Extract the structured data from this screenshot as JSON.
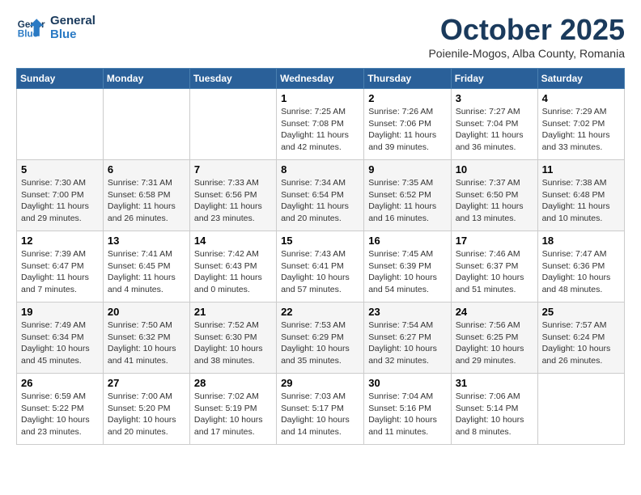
{
  "header": {
    "logo_line1": "General",
    "logo_line2": "Blue",
    "month": "October 2025",
    "location": "Poienile-Mogos, Alba County, Romania"
  },
  "days_of_week": [
    "Sunday",
    "Monday",
    "Tuesday",
    "Wednesday",
    "Thursday",
    "Friday",
    "Saturday"
  ],
  "weeks": [
    [
      {
        "day": "",
        "info": ""
      },
      {
        "day": "",
        "info": ""
      },
      {
        "day": "",
        "info": ""
      },
      {
        "day": "1",
        "info": "Sunrise: 7:25 AM\nSunset: 7:08 PM\nDaylight: 11 hours\nand 42 minutes."
      },
      {
        "day": "2",
        "info": "Sunrise: 7:26 AM\nSunset: 7:06 PM\nDaylight: 11 hours\nand 39 minutes."
      },
      {
        "day": "3",
        "info": "Sunrise: 7:27 AM\nSunset: 7:04 PM\nDaylight: 11 hours\nand 36 minutes."
      },
      {
        "day": "4",
        "info": "Sunrise: 7:29 AM\nSunset: 7:02 PM\nDaylight: 11 hours\nand 33 minutes."
      }
    ],
    [
      {
        "day": "5",
        "info": "Sunrise: 7:30 AM\nSunset: 7:00 PM\nDaylight: 11 hours\nand 29 minutes."
      },
      {
        "day": "6",
        "info": "Sunrise: 7:31 AM\nSunset: 6:58 PM\nDaylight: 11 hours\nand 26 minutes."
      },
      {
        "day": "7",
        "info": "Sunrise: 7:33 AM\nSunset: 6:56 PM\nDaylight: 11 hours\nand 23 minutes."
      },
      {
        "day": "8",
        "info": "Sunrise: 7:34 AM\nSunset: 6:54 PM\nDaylight: 11 hours\nand 20 minutes."
      },
      {
        "day": "9",
        "info": "Sunrise: 7:35 AM\nSunset: 6:52 PM\nDaylight: 11 hours\nand 16 minutes."
      },
      {
        "day": "10",
        "info": "Sunrise: 7:37 AM\nSunset: 6:50 PM\nDaylight: 11 hours\nand 13 minutes."
      },
      {
        "day": "11",
        "info": "Sunrise: 7:38 AM\nSunset: 6:48 PM\nDaylight: 11 hours\nand 10 minutes."
      }
    ],
    [
      {
        "day": "12",
        "info": "Sunrise: 7:39 AM\nSunset: 6:47 PM\nDaylight: 11 hours\nand 7 minutes."
      },
      {
        "day": "13",
        "info": "Sunrise: 7:41 AM\nSunset: 6:45 PM\nDaylight: 11 hours\nand 4 minutes."
      },
      {
        "day": "14",
        "info": "Sunrise: 7:42 AM\nSunset: 6:43 PM\nDaylight: 11 hours\nand 0 minutes."
      },
      {
        "day": "15",
        "info": "Sunrise: 7:43 AM\nSunset: 6:41 PM\nDaylight: 10 hours\nand 57 minutes."
      },
      {
        "day": "16",
        "info": "Sunrise: 7:45 AM\nSunset: 6:39 PM\nDaylight: 10 hours\nand 54 minutes."
      },
      {
        "day": "17",
        "info": "Sunrise: 7:46 AM\nSunset: 6:37 PM\nDaylight: 10 hours\nand 51 minutes."
      },
      {
        "day": "18",
        "info": "Sunrise: 7:47 AM\nSunset: 6:36 PM\nDaylight: 10 hours\nand 48 minutes."
      }
    ],
    [
      {
        "day": "19",
        "info": "Sunrise: 7:49 AM\nSunset: 6:34 PM\nDaylight: 10 hours\nand 45 minutes."
      },
      {
        "day": "20",
        "info": "Sunrise: 7:50 AM\nSunset: 6:32 PM\nDaylight: 10 hours\nand 41 minutes."
      },
      {
        "day": "21",
        "info": "Sunrise: 7:52 AM\nSunset: 6:30 PM\nDaylight: 10 hours\nand 38 minutes."
      },
      {
        "day": "22",
        "info": "Sunrise: 7:53 AM\nSunset: 6:29 PM\nDaylight: 10 hours\nand 35 minutes."
      },
      {
        "day": "23",
        "info": "Sunrise: 7:54 AM\nSunset: 6:27 PM\nDaylight: 10 hours\nand 32 minutes."
      },
      {
        "day": "24",
        "info": "Sunrise: 7:56 AM\nSunset: 6:25 PM\nDaylight: 10 hours\nand 29 minutes."
      },
      {
        "day": "25",
        "info": "Sunrise: 7:57 AM\nSunset: 6:24 PM\nDaylight: 10 hours\nand 26 minutes."
      }
    ],
    [
      {
        "day": "26",
        "info": "Sunrise: 6:59 AM\nSunset: 5:22 PM\nDaylight: 10 hours\nand 23 minutes."
      },
      {
        "day": "27",
        "info": "Sunrise: 7:00 AM\nSunset: 5:20 PM\nDaylight: 10 hours\nand 20 minutes."
      },
      {
        "day": "28",
        "info": "Sunrise: 7:02 AM\nSunset: 5:19 PM\nDaylight: 10 hours\nand 17 minutes."
      },
      {
        "day": "29",
        "info": "Sunrise: 7:03 AM\nSunset: 5:17 PM\nDaylight: 10 hours\nand 14 minutes."
      },
      {
        "day": "30",
        "info": "Sunrise: 7:04 AM\nSunset: 5:16 PM\nDaylight: 10 hours\nand 11 minutes."
      },
      {
        "day": "31",
        "info": "Sunrise: 7:06 AM\nSunset: 5:14 PM\nDaylight: 10 hours\nand 8 minutes."
      },
      {
        "day": "",
        "info": ""
      }
    ]
  ]
}
